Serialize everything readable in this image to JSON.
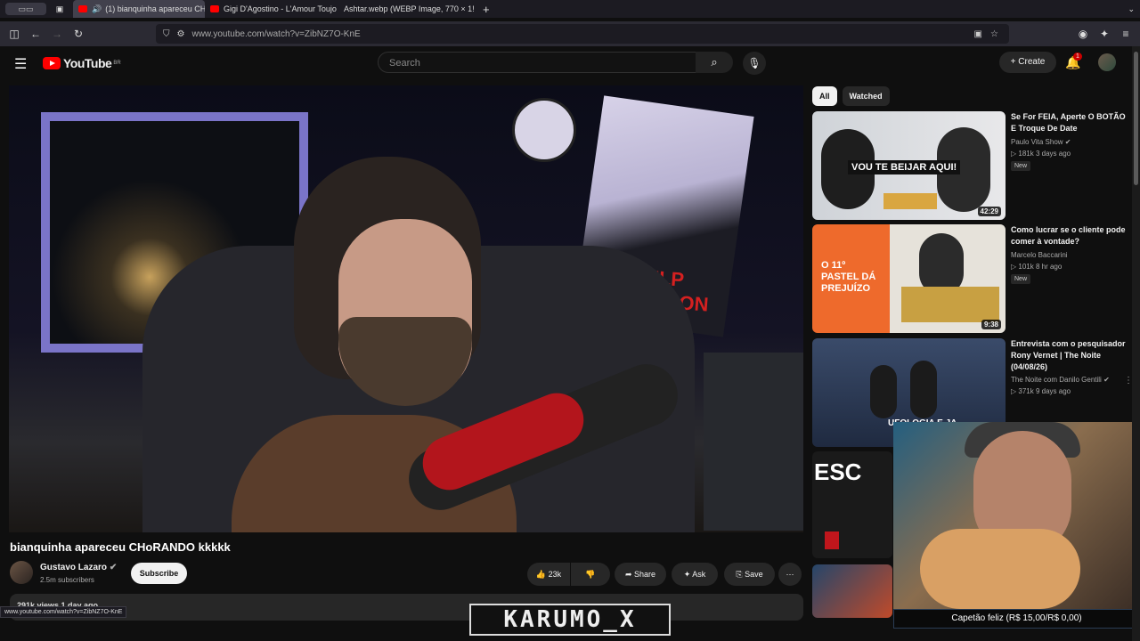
{
  "browser": {
    "tabs": [
      {
        "label": "(1) bianquinha apareceu CH",
        "active": true
      },
      {
        "label": "Gigi D'Agostino - L'Amour Toujo",
        "active": false
      },
      {
        "label": "Ashtar.webp (WEBP Image, 770 × 1!",
        "active": false
      }
    ],
    "url": "www.youtube.com/watch?v=ZibNZ7O-KnE",
    "status_url": "www.youtube.com/watch?v=ZibNZ7O-KnE"
  },
  "header": {
    "logo": "YouTube",
    "region": "BR",
    "search_placeholder": "Search",
    "create_label": "Create",
    "notifications": "1"
  },
  "video": {
    "title": "bianquinha apareceu CHoRANDO kkkkk",
    "poster_text": "PULP FICTION",
    "channel": "Gustavo Lazaro",
    "subscribers": "2.5m subscribers",
    "subscribe_label": "Subscribe",
    "likes": "23k",
    "share_label": "Share",
    "ask_label": "Ask",
    "save_label": "Save",
    "desc_peek": "291k views 1 day ago"
  },
  "chips": [
    {
      "label": "All",
      "active": true
    },
    {
      "label": "Watched",
      "active": false
    }
  ],
  "recommendations": [
    {
      "title": "Se For FEIA, Aperte O BOTÃO E Troque De Date",
      "channel": "Paulo Vita Show",
      "meta": "181k 3 days ago",
      "badge": "New",
      "duration": "42:29",
      "thumb_text": "VOU TE BEIJAR AQUI!"
    },
    {
      "title": "Como lucrar se o cliente pode comer à vontade?",
      "channel": "Marcelo Baccarini",
      "meta": "101k 8 hr ago",
      "badge": "New",
      "duration": "9:38",
      "thumb_text": "O 11º PASTEL DÁ PREJUÍZO"
    },
    {
      "title": "Entrevista com o pesquisador Rony Vernet | The Noite (04/08/26)",
      "channel": "The Noite com Danilo Gentili",
      "meta": "371k 9 days ago",
      "badge": "",
      "duration": "",
      "thumb_text": "UFOLOGIA E JA"
    }
  ],
  "overlay": {
    "cam_label": "Capetão feliz (R$ 15,00/R$ 0,00)",
    "streamer_name": "KARUMO_X"
  },
  "colors": {
    "bg": "#0f0f0f",
    "brand": "#ff0000",
    "chip": "#272727"
  }
}
